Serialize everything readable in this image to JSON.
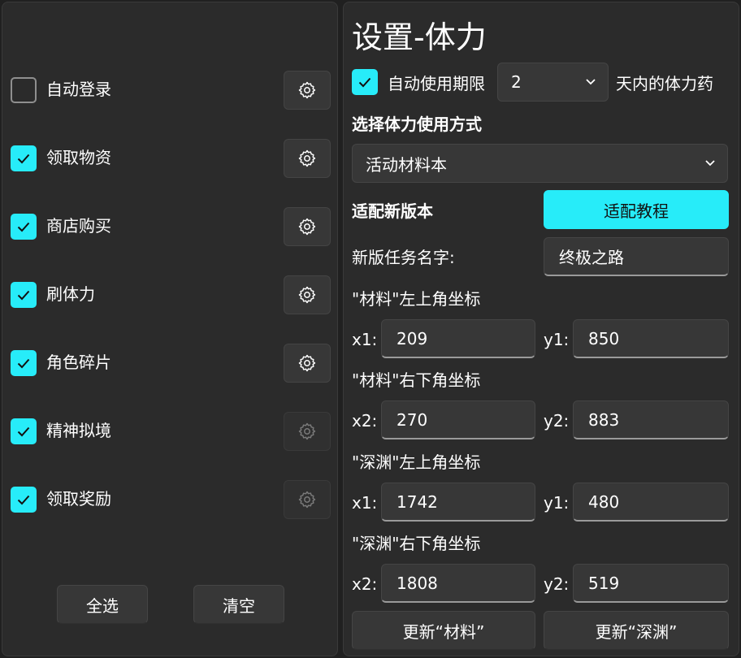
{
  "tasks": [
    {
      "label": "自动登录",
      "checked": false,
      "settings_enabled": true
    },
    {
      "label": "领取物资",
      "checked": true,
      "settings_enabled": true
    },
    {
      "label": "商店购买",
      "checked": true,
      "settings_enabled": true
    },
    {
      "label": "刷体力",
      "checked": true,
      "settings_enabled": true
    },
    {
      "label": "角色碎片",
      "checked": true,
      "settings_enabled": true
    },
    {
      "label": "精神拟境",
      "checked": true,
      "settings_enabled": false
    },
    {
      "label": "领取奖励",
      "checked": true,
      "settings_enabled": false
    }
  ],
  "left_buttons": {
    "select_all": "全选",
    "clear": "清空"
  },
  "settings": {
    "title": "设置-体力",
    "auto_use_label": "自动使用期限",
    "auto_use_checked": true,
    "days_value": "2",
    "days_suffix": "天内的体力药",
    "method_heading": "选择体力使用方式",
    "method_value": "活动材料本",
    "adapt_heading": "适配新版本",
    "tutorial_button": "适配教程",
    "task_name_label": "新版任务名字:",
    "task_name_value": "终极之路",
    "coord_groups": [
      {
        "title": "\"材料\"左上角坐标",
        "label_a": "x1:",
        "value_a": "209",
        "label_b": "y1:",
        "value_b": "850"
      },
      {
        "title": "\"材料\"右下角坐标",
        "label_a": "x2:",
        "value_a": "270",
        "label_b": "y2:",
        "value_b": "883"
      },
      {
        "title": "\"深渊\"左上角坐标",
        "label_a": "x1:",
        "value_a": "1742",
        "label_b": "y1:",
        "value_b": "480"
      },
      {
        "title": "\"深渊\"右下角坐标",
        "label_a": "x2:",
        "value_a": "1808",
        "label_b": "y2:",
        "value_b": "519"
      }
    ],
    "update_material_button": "更新“材料”",
    "update_abyss_button": "更新“深渊”"
  },
  "colors": {
    "accent": "#27ecf9",
    "panel_bg": "#2b2b2b",
    "window_bg": "#202020"
  },
  "icons": {
    "settings": "gear-icon",
    "check": "checkmark-icon",
    "dropdown": "chevron-down-icon"
  }
}
